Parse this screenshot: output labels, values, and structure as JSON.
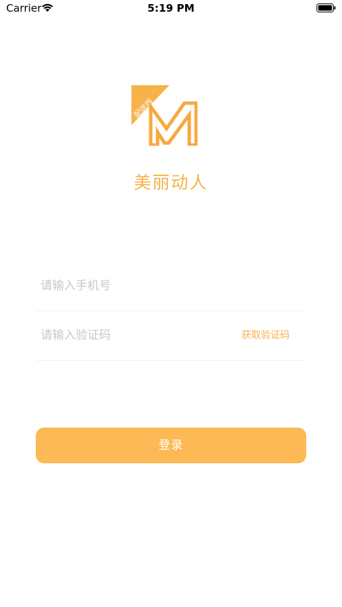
{
  "status_bar": {
    "carrier": "Carrier",
    "time": "5:19 PM",
    "icons": [
      "wifi-icon",
      "battery-icon"
    ]
  },
  "logo": {
    "badge_text": "配送端",
    "letter": "M"
  },
  "app_name": "美丽动人",
  "form": {
    "phone_placeholder": "请输入手机号",
    "phone_value": "",
    "code_placeholder": "请输入验证码",
    "code_value": "",
    "get_code_label": "获取验证码",
    "login_label": "登录"
  },
  "colors": {
    "accent": "#F7B24A",
    "button": "#FDB955",
    "placeholder": "#C8C8C8",
    "divider": "#FCEFE0"
  }
}
